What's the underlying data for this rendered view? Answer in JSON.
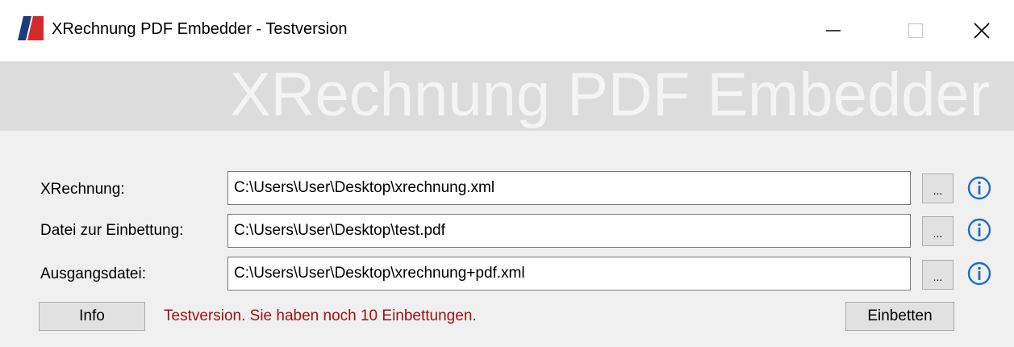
{
  "window": {
    "title": "XRechnung PDF Embedder - Testversion",
    "icons": {
      "app": "app-logo-icon",
      "minimize": "minimize-icon",
      "maximize": "maximize-icon",
      "close": "close-icon"
    }
  },
  "banner": {
    "title": "XRechnung PDF Embedder"
  },
  "form": {
    "xrechnung": {
      "label": "XRechnung:",
      "value": "C:\\Users\\User\\Desktop\\xrechnung.xml",
      "browse_label": "..."
    },
    "embed_file": {
      "label": "Datei zur Einbettung:",
      "value": "C:\\Users\\User\\Desktop\\test.pdf",
      "browse_label": "..."
    },
    "output_file": {
      "label": "Ausgangsdatei:",
      "value": "C:\\Users\\User\\Desktop\\xrechnung+pdf.xml",
      "browse_label": "..."
    }
  },
  "footer": {
    "info_label": "Info",
    "status": "Testversion. Sie haben noch 10 Einbettungen.",
    "embed_label": "Einbetten"
  },
  "colors": {
    "status_text": "#a01010",
    "info_icon": "#1e6ec8",
    "logo_red": "#d62a2a",
    "logo_blue": "#1f3a7a",
    "banner_bg": "#dcdcdc"
  }
}
